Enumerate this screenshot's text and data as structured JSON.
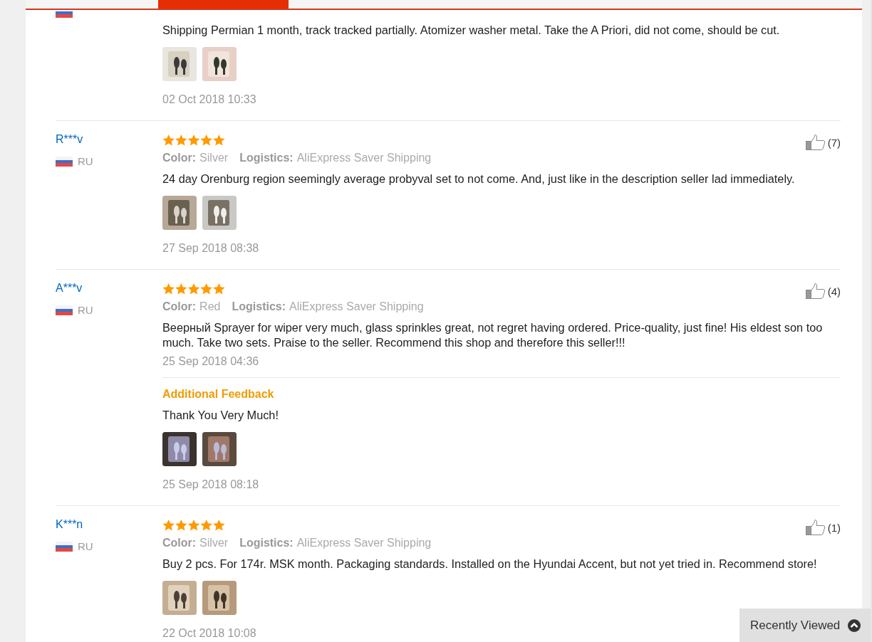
{
  "reviews": [
    {
      "text": "Shipping Permian 1 month, track tracked partially. Atomizer washer metal. Take the A Priori, did not come, should be cut.",
      "photos": [
        {
          "kind": "picture"
        },
        {
          "kind": "picture"
        }
      ],
      "date": "02 Oct 2018 10:33"
    },
    {
      "user": "R***v",
      "country": "RU",
      "stars": 5,
      "helpful": "(7)",
      "meta": [
        {
          "label": "Color:",
          "value": "Silver"
        },
        {
          "label": "Logistics:",
          "value": "AliExpress Saver Shipping"
        }
      ],
      "text": "24 day Orenburg region seemingly average probyval set to not come. And, just like in the description seller lad immediately.",
      "photos": [
        {
          "kind": "picture"
        },
        {
          "kind": "picture"
        }
      ],
      "date": "27 Sep 2018 08:38"
    },
    {
      "user": "A***v",
      "country": "RU",
      "stars": 5,
      "helpful": "(4)",
      "meta": [
        {
          "label": "Color:",
          "value": "Red"
        },
        {
          "label": "Logistics:",
          "value": "AliExpress Saver Shipping"
        }
      ],
      "text": "Веерный Sprayer for wiper very much, glass sprinkles great, not regret having ordered. Price-quality, just fine! His eldest son too much. Take two sets. Praise to the seller. Recommend this shop and therefore this seller!!!",
      "date": "25 Sep 2018 04:36",
      "additional": {
        "title": "Additional Feedback",
        "text": "Thank You Very Much!",
        "photos": [
          {
            "kind": "picture"
          },
          {
            "kind": "picture"
          }
        ],
        "date": "25 Sep 2018 08:18"
      }
    },
    {
      "user": "K***n",
      "country": "RU",
      "stars": 5,
      "helpful": "(1)",
      "meta": [
        {
          "label": "Color:",
          "value": "Silver"
        },
        {
          "label": "Logistics:",
          "value": "AliExpress Saver Shipping"
        }
      ],
      "text": "Buy 2 pcs. For 174r. MSK month. Packaging standards. Installed on the Hyundai Accent, but not yet tried in. Recommend store!",
      "photos": [
        {
          "kind": "picture"
        },
        {
          "kind": "picture"
        }
      ],
      "date": "22 Oct 2018 10:08"
    }
  ],
  "recently_viewed": {
    "label": "Recently Viewed"
  }
}
